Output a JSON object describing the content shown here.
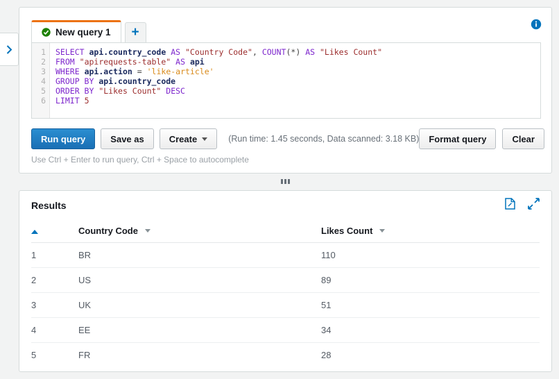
{
  "sidebar": {
    "expand_icon": "chevron-right-icon"
  },
  "query_panel": {
    "info_icon": "info-circle-icon",
    "tabs": [
      {
        "label": "New query 1",
        "status_icon": "check-circle-icon",
        "active": true
      }
    ],
    "add_tab_label": "+",
    "editor": {
      "line_numbers": [
        "1",
        "2",
        "3",
        "4",
        "5",
        "6"
      ],
      "lines": [
        "SELECT api.country_code AS \"Country Code\", COUNT(*) AS \"Likes Count\"",
        "FROM \"apirequests-table\" AS api",
        "WHERE api.action = 'like-article'",
        "GROUP BY api.country_code",
        "ORDER BY \"Likes Count\" DESC",
        "LIMIT 5"
      ]
    },
    "buttons": {
      "run_query": "Run query",
      "save_as": "Save as",
      "create": "Create",
      "format_query": "Format query",
      "clear": "Clear"
    },
    "run_stats": "(Run time: 1.45 seconds, Data scanned: 3.18 KB)",
    "hint": "Use Ctrl + Enter to run query, Ctrl + Space to autocomplete"
  },
  "splitter": {
    "handle_icon": "drag-handle-icon"
  },
  "results_panel": {
    "title": "Results",
    "download_icon": "download-file-icon",
    "expand_icon": "expand-arrows-icon",
    "columns": [
      "",
      "Country Code",
      "Likes Count"
    ],
    "rows": [
      {
        "index": "1",
        "country_code": "BR",
        "likes_count": "110"
      },
      {
        "index": "2",
        "country_code": "US",
        "likes_count": "89"
      },
      {
        "index": "3",
        "country_code": "UK",
        "likes_count": "51"
      },
      {
        "index": "4",
        "country_code": "EE",
        "likes_count": "34"
      },
      {
        "index": "5",
        "country_code": "FR",
        "likes_count": "28"
      }
    ]
  },
  "colors": {
    "accent_blue": "#0073bb",
    "tab_orange": "#ec7211",
    "primary_button": "#1a6fb5",
    "status_green": "#1d8102",
    "page_bg": "#f2f3f3"
  }
}
